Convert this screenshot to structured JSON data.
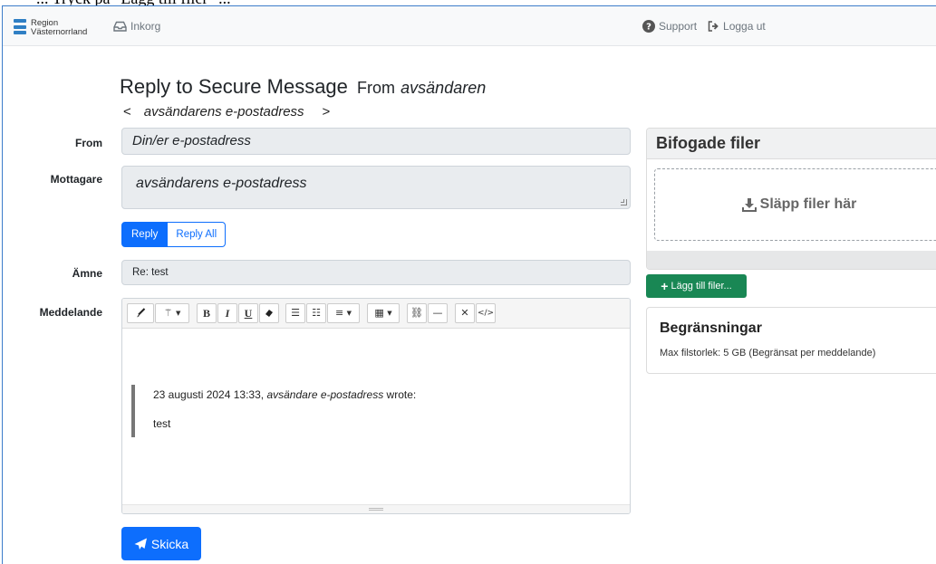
{
  "navbar": {
    "logo_line1": "Region",
    "logo_line2": "Västernorrland",
    "inbox_label": "Inkorg",
    "support_label": "Support",
    "logout_label": "Logga ut"
  },
  "header": {
    "title": "Reply to Secure Message",
    "from_word": "From",
    "from_name": "avsändaren",
    "sender_open": "<",
    "sender_address": "avsändarens e-postadress",
    "sender_close": ">"
  },
  "form": {
    "from_label": "From",
    "from_value": "Din/er e-postadress",
    "recipient_label": "Mottagare",
    "recipient_value": "avsändarens e-postadress",
    "reply_label": "Reply",
    "reply_all_label": "Reply All",
    "subject_label": "Ämne",
    "subject_value": "Re: test",
    "message_label": "Meddelande",
    "quote_date": "23 augusti 2024 13:33,",
    "quote_sender": "avsändare e-postadress",
    "quote_wrote": "wrote:",
    "quote_body": "test",
    "send_label": "Skicka"
  },
  "attachments": {
    "title": "Bifogade filer",
    "drop_label": "Släpp filer här",
    "add_label": "Lägg till filer..."
  },
  "limits": {
    "title": "Begränsningar",
    "text": "Max filstorlek: 5 GB (Begränsat per meddelande)"
  },
  "colors": {
    "primary": "#0d6efd",
    "success": "#198754"
  }
}
